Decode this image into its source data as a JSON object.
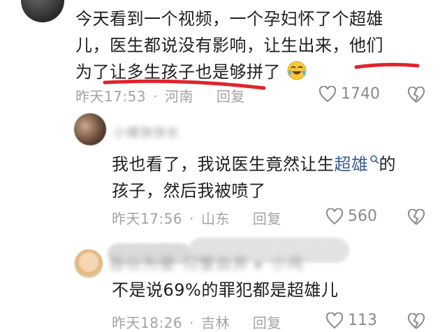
{
  "comment_main": {
    "lines": [
      "今天看到一个视频，一个孕妇怀了个超雄",
      "儿，医生都说没有影响，让生出来，他们",
      "为了让多生孩子也是够拼了"
    ],
    "emoji": "laugh-cry-emoji",
    "time": "昨天17:53",
    "location": "河南",
    "reply_label": "回复",
    "likes": "1740"
  },
  "reply_1": {
    "username": "小猪快快长",
    "lines": [
      "我也看了，我说医生竟然让生",
      "的",
      "孩子，然后我被喷了"
    ],
    "link_text": "超雄",
    "time": "昨天17:56",
    "location": "山东",
    "reply_label": "回复",
    "likes": "560"
  },
  "reply_2": {
    "username": "自以为是",
    "username_extra": "河蟹自弃",
    "arrow_target": "小鸡",
    "text": "不是说69%的罪犯都是超雄儿",
    "time": "昨天18:26",
    "location": "吉林",
    "reply_label": "回复",
    "likes": "113"
  },
  "colors": {
    "underline_red": "#e0242a",
    "meta_gray": "#a3a3a3",
    "link_blue": "#3b5d8f"
  }
}
